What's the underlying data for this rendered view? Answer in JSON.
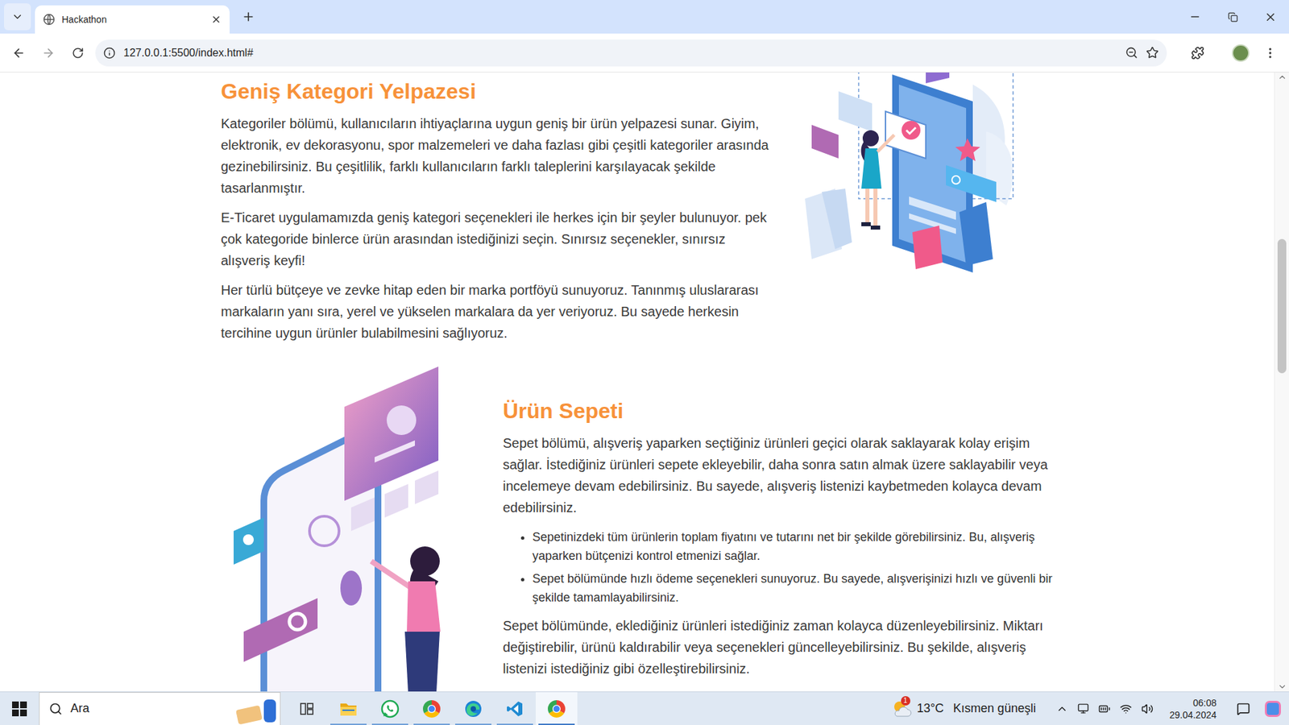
{
  "browser": {
    "tabs": [
      {
        "title": "Hackathon",
        "selected": true
      }
    ],
    "address": "127.0.0.1:5500/index.html#"
  },
  "page": {
    "sections": [
      {
        "heading": "Geniş Kategori Yelpazesi",
        "image_side": "right",
        "paragraphs": [
          "Kategoriler bölümü, kullanıcıların ihtiyaçlarına uygun geniş bir ürün yelpazesi sunar. Giyim, elektronik, ev dekorasyonu, spor malzemeleri ve daha fazlası gibi çeşitli kategoriler arasında gezinebilirsiniz. Bu çeşitlilik, farklı kullanıcıların farklı taleplerini karşılayacak şekilde tasarlanmıştır.",
          "E-Ticaret uygulamamızda geniş kategori seçenekleri ile herkes için bir şeyler bulunuyor. pek çok kategoride binlerce ürün arasından istediğinizi seçin. Sınırsız seçenekler, sınırsız alışveriş keyfi!",
          "Her türlü bütçeye ve zevke hitap eden bir marka portföyü sunuyoruz. Tanınmış uluslararası markaların yanı sıra, yerel ve yükselen markalara da yer veriyoruz. Bu sayede herkesin tercihine uygun ürünler bulabilmesini sağlıyoruz."
        ],
        "bullets": [],
        "closing": []
      },
      {
        "heading": "Ürün Sepeti",
        "image_side": "left",
        "paragraphs": [
          "Sepet bölümü, alışveriş yaparken seçtiğiniz ürünleri geçici olarak saklayarak kolay erişim sağlar. İstediğiniz ürünleri sepete ekleyebilir, daha sonra satın almak üzere saklayabilir veya incelemeye devam edebilirsiniz. Bu sayede, alışveriş listenizi kaybetmeden kolayca devam edebilirsiniz."
        ],
        "bullets": [
          "Sepetinizdeki tüm ürünlerin toplam fiyatını ve tutarını net bir şekilde görebilirsiniz. Bu, alışveriş yaparken bütçenizi kontrol etmenizi sağlar.",
          "Sepet bölümünde hızlı ödeme seçenekleri sunuyoruz. Bu sayede, alışverişinizi hızlı ve güvenli bir şekilde tamamlayabilirsiniz."
        ],
        "closing": [
          "Sepet bölümünde, eklediğiniz ürünleri istediğiniz zaman kolayca düzenleyebilirsiniz. Miktarı değiştirebilir, ürünü kaldırabilir veya seçenekleri güncelleyebilirsiniz. Bu şekilde, alışveriş listenizi istediğiniz gibi özelleştirebilirsiniz."
        ]
      }
    ]
  },
  "scrollbar": {
    "level": 0.36
  },
  "taskbar": {
    "search": "Ara",
    "apps": [
      {
        "kind": "taskview",
        "running": false,
        "selected": false
      },
      {
        "kind": "explorer",
        "running": true,
        "selected": false
      },
      {
        "kind": "whatsapp",
        "running": true,
        "selected": false
      },
      {
        "kind": "chrome",
        "running": true,
        "selected": false
      },
      {
        "kind": "edge",
        "running": true,
        "selected": false
      },
      {
        "kind": "vscode",
        "running": true,
        "selected": false
      },
      {
        "kind": "chrome",
        "running": true,
        "selected": true
      }
    ],
    "weather": {
      "temperature": "13°C",
      "condition": "Kısmen güneşli",
      "badge": "1"
    },
    "clock": {
      "time": "06:08",
      "date": "29.04.2024"
    }
  }
}
